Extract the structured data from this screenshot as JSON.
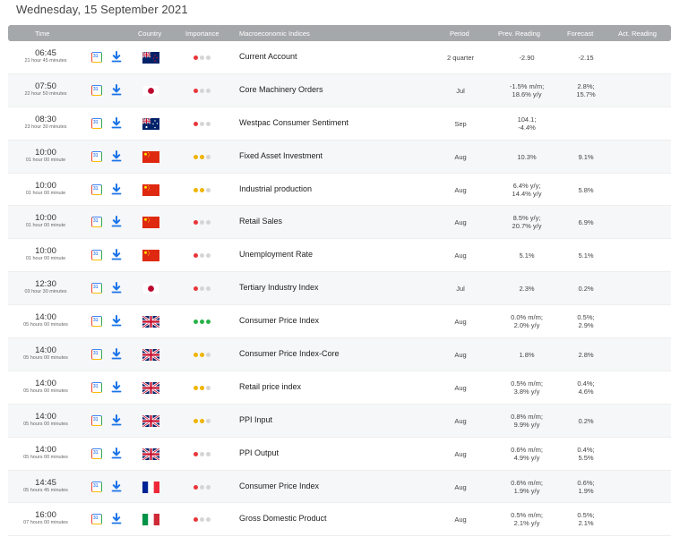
{
  "date_title": "Wednesday, 15 September 2021",
  "headers": {
    "time": "Time",
    "country": "Country",
    "importance": "Importance",
    "indices": "Macroeconomic Indices",
    "period": "Period",
    "prev": "Prev. Reading",
    "forecast": "Forecast",
    "actual": "Act. Reading"
  },
  "colors": {
    "header_bg": "#a5a8ab",
    "importance_high": "#2ab24a",
    "importance_medium": "#f0b400",
    "importance_low": "#e8363a",
    "download_icon": "#1a73e8"
  },
  "rows": [
    {
      "time": "06:45",
      "remaining": "21 hour 45 minutes",
      "flag": "new-zealand",
      "importance": "low",
      "importance_level": 1,
      "name": "Current Account",
      "period": "2 quarter",
      "prev": [
        "-2.90"
      ],
      "forecast": [
        "-2.15"
      ],
      "actual": []
    },
    {
      "time": "07:50",
      "remaining": "22 hour 50 minutes",
      "flag": "japan",
      "importance": "low",
      "importance_level": 1,
      "name": "Core Machinery Orders",
      "period": "Jul",
      "prev": [
        "-1.5% m/m;",
        "18.6% y/y"
      ],
      "forecast": [
        "2.8%;",
        "15.7%"
      ],
      "actual": []
    },
    {
      "time": "08:30",
      "remaining": "23 hour 30 minutes",
      "flag": "australia",
      "importance": "low",
      "importance_level": 1,
      "name": "Westpac Consumer Sentiment",
      "period": "Sep",
      "prev": [
        "104.1;",
        "-4.4%"
      ],
      "forecast": [],
      "actual": []
    },
    {
      "time": "10:00",
      "remaining": "01 hour 00 minute",
      "flag": "china",
      "importance": "medium",
      "importance_level": 2,
      "name": "Fixed Asset Investment",
      "period": "Aug",
      "prev": [
        "10.3%"
      ],
      "forecast": [
        "9.1%"
      ],
      "actual": []
    },
    {
      "time": "10:00",
      "remaining": "01 hour 00 minute",
      "flag": "china",
      "importance": "medium",
      "importance_level": 2,
      "name": "Industrial production",
      "period": "Aug",
      "prev": [
        "6.4% y/y;",
        "14.4% y/y"
      ],
      "forecast": [
        "5.8%"
      ],
      "actual": []
    },
    {
      "time": "10:00",
      "remaining": "01 hour 00 minute",
      "flag": "china",
      "importance": "low",
      "importance_level": 1,
      "name": "Retail Sales",
      "period": "Aug",
      "prev": [
        "8.5% y/y;",
        "20.7% y/y"
      ],
      "forecast": [
        "6.9%"
      ],
      "actual": []
    },
    {
      "time": "10:00",
      "remaining": "01 hour 00 minute",
      "flag": "china",
      "importance": "low",
      "importance_level": 1,
      "name": "Unemployment Rate",
      "period": "Aug",
      "prev": [
        "5.1%"
      ],
      "forecast": [
        "5.1%"
      ],
      "actual": []
    },
    {
      "time": "12:30",
      "remaining": "03 hour 30 minutes",
      "flag": "japan",
      "importance": "low",
      "importance_level": 1,
      "name": "Tertiary Industry Index",
      "period": "Jul",
      "prev": [
        "2.3%"
      ],
      "forecast": [
        "0.2%"
      ],
      "actual": []
    },
    {
      "time": "14:00",
      "remaining": "05 hours 00 minutes",
      "flag": "united-kingdom",
      "importance": "high",
      "importance_level": 3,
      "name": "Consumer Price Index",
      "period": "Aug",
      "prev": [
        "0.0% m/m;",
        "2.0% y/y"
      ],
      "forecast": [
        "0.5%;",
        "2.9%"
      ],
      "actual": []
    },
    {
      "time": "14:00",
      "remaining": "05 hours 00 minutes",
      "flag": "united-kingdom",
      "importance": "medium",
      "importance_level": 2,
      "name": "Consumer Price Index-Core",
      "period": "Aug",
      "prev": [
        "1.8%"
      ],
      "forecast": [
        "2.8%"
      ],
      "actual": []
    },
    {
      "time": "14:00",
      "remaining": "05 hours 00 minutes",
      "flag": "united-kingdom",
      "importance": "medium",
      "importance_level": 2,
      "name": "Retail price index",
      "period": "Aug",
      "prev": [
        "0.5% m/m;",
        "3.8% y/y"
      ],
      "forecast": [
        "0.4%;",
        "4.6%"
      ],
      "actual": []
    },
    {
      "time": "14:00",
      "remaining": "05 hours 00 minutes",
      "flag": "united-kingdom",
      "importance": "medium",
      "importance_level": 2,
      "name": "PPI Input",
      "period": "Aug",
      "prev": [
        "0.8% m/m;",
        "9.9% y/y"
      ],
      "forecast": [
        "0.2%"
      ],
      "actual": []
    },
    {
      "time": "14:00",
      "remaining": "05 hours 00 minutes",
      "flag": "united-kingdom",
      "importance": "low",
      "importance_level": 1,
      "name": "PPI Output",
      "period": "Aug",
      "prev": [
        "0.6% m/m;",
        "4.9% y/y"
      ],
      "forecast": [
        "0.4%;",
        "5.5%"
      ],
      "actual": []
    },
    {
      "time": "14:45",
      "remaining": "05 hours 45 minutes",
      "flag": "france",
      "importance": "low",
      "importance_level": 1,
      "name": "Consumer Price Index",
      "period": "Aug",
      "prev": [
        "0.6% m/m;",
        "1.9% y/y"
      ],
      "forecast": [
        "0.6%;",
        "1.9%"
      ],
      "actual": []
    },
    {
      "time": "16:00",
      "remaining": "07 hours 00 minutes",
      "flag": "italy",
      "importance": "low",
      "importance_level": 1,
      "name": "Gross Domestic Product",
      "period": "Aug",
      "prev": [
        "0.5% m/m;",
        "2.1% y/y"
      ],
      "forecast": [
        "0.5%;",
        "2.1%"
      ],
      "actual": []
    }
  ]
}
